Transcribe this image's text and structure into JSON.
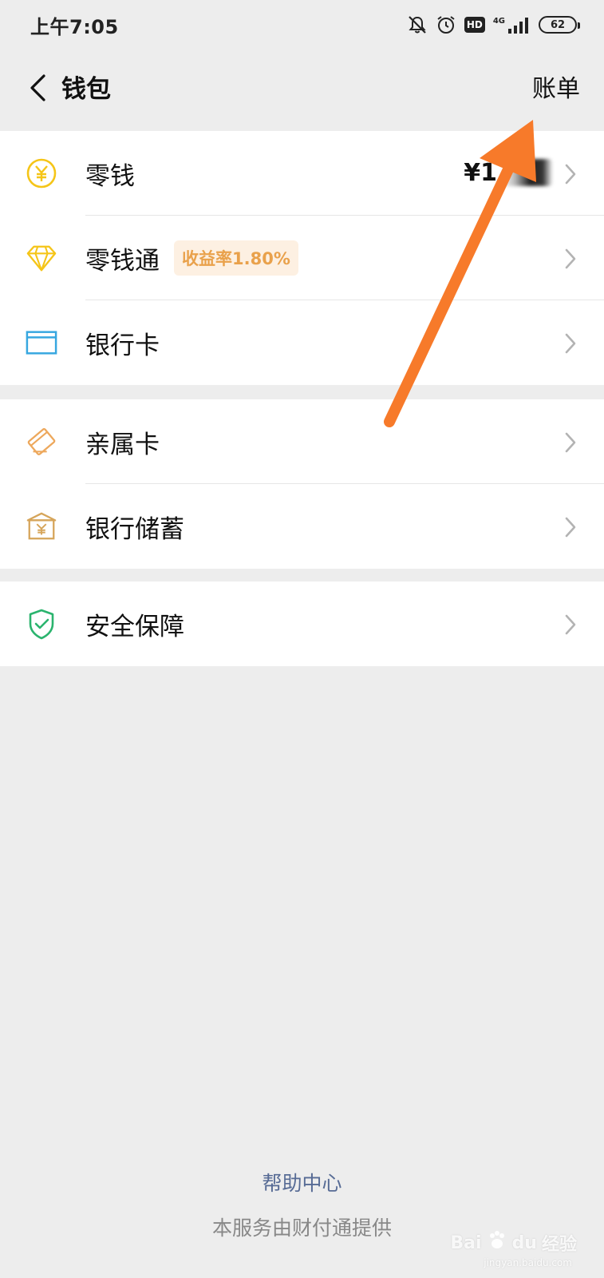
{
  "status_bar": {
    "time": "上午7:05",
    "hd": "HD",
    "network": "4G",
    "battery": "62"
  },
  "nav": {
    "title": "钱包",
    "bill": "账单"
  },
  "groups": [
    {
      "items": [
        {
          "label": "零钱",
          "icon": "yuan-coin-icon",
          "balance_prefix": "¥1"
        },
        {
          "label": "零钱通",
          "icon": "diamond-icon",
          "badge": "收益率1.80%"
        },
        {
          "label": "银行卡",
          "icon": "bank-card-icon"
        }
      ]
    },
    {
      "items": [
        {
          "label": "亲属卡",
          "icon": "family-card-icon"
        },
        {
          "label": "银行储蓄",
          "icon": "bank-savings-icon"
        }
      ]
    },
    {
      "items": [
        {
          "label": "安全保障",
          "icon": "security-shield-icon"
        }
      ]
    }
  ],
  "footer": {
    "help": "帮助中心",
    "provider": "本服务由财付通提供"
  },
  "watermark": {
    "brand": "Bai",
    "brand_paw": "du",
    "brand_cn": "经验",
    "url": "jingyan.baidu.com"
  },
  "colors": {
    "background": "#ededed",
    "link": "#576b95",
    "badge_text": "#e9a14b",
    "badge_bg": "#fdf0e2",
    "coin_yellow": "#f5c518",
    "card_blue": "#37a7e0",
    "family_orange": "#eda85c",
    "savings_gold": "#d6a55a",
    "shield_green": "#2bb46e",
    "annotation_arrow": "#f77a2a"
  }
}
